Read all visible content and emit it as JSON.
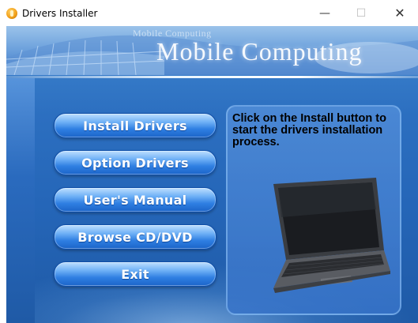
{
  "window": {
    "title": "Drivers Installer",
    "minimize_glyph": "—",
    "maximize_glyph": "☐",
    "close_glyph": "✕"
  },
  "banner": {
    "small_text": "Mobile Computing",
    "title": "Mobile Computing"
  },
  "menu": {
    "install_label": "Install Drivers",
    "option_label": "Option Drivers",
    "manual_label": "User's Manual",
    "browse_label": "Browse CD/DVD",
    "exit_label": "Exit"
  },
  "info": {
    "text": "Click on the Install button to start the drivers installation process."
  },
  "colors": {
    "button_blue": "#2f7fe2",
    "background_blue": "#2c6fc0"
  }
}
